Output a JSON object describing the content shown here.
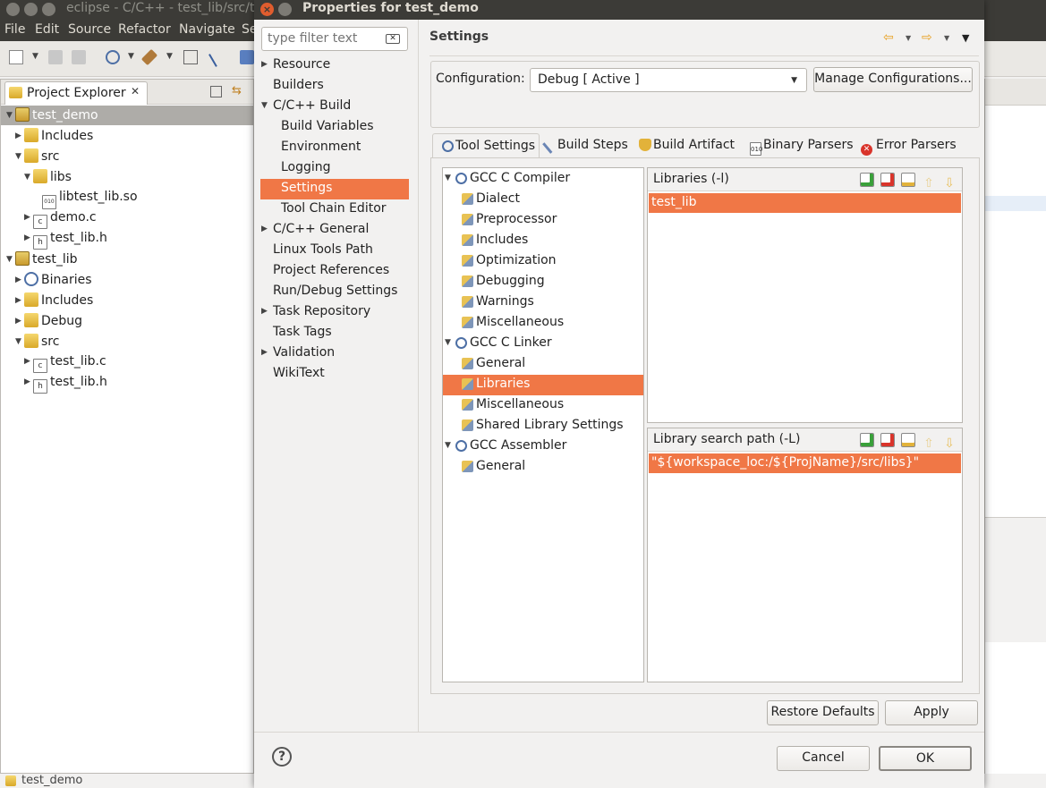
{
  "eclipse": {
    "title": "eclipse - C/C++ - test_lib/src/t",
    "menu": [
      "File",
      "Edit",
      "Source",
      "Refactor",
      "Navigate",
      "Se"
    ],
    "project_explorer": {
      "tab_label": "Project Explorer",
      "tree": [
        {
          "label": "test_demo",
          "depth": 0,
          "expanded": true,
          "icon": "project-icon",
          "selected": true
        },
        {
          "label": "Includes",
          "depth": 1,
          "expanded": false,
          "icon": "includes-icon"
        },
        {
          "label": "src",
          "depth": 1,
          "expanded": true,
          "icon": "folder-icon"
        },
        {
          "label": "libs",
          "depth": 2,
          "expanded": true,
          "icon": "folder-icon"
        },
        {
          "label": "libtest_lib.so",
          "depth": 3,
          "icon": "binary-file-icon"
        },
        {
          "label": "demo.c",
          "depth": 2,
          "expanded": false,
          "icon": "c-file-icon"
        },
        {
          "label": "test_lib.h",
          "depth": 2,
          "expanded": false,
          "icon": "h-file-icon"
        },
        {
          "label": "test_lib",
          "depth": 0,
          "expanded": true,
          "icon": "project-icon"
        },
        {
          "label": "Binaries",
          "depth": 1,
          "expanded": false,
          "icon": "binaries-icon"
        },
        {
          "label": "Includes",
          "depth": 1,
          "expanded": false,
          "icon": "includes-icon"
        },
        {
          "label": "Debug",
          "depth": 1,
          "expanded": false,
          "icon": "folder-icon"
        },
        {
          "label": "src",
          "depth": 1,
          "expanded": true,
          "icon": "folder-icon"
        },
        {
          "label": "test_lib.c",
          "depth": 2,
          "expanded": false,
          "icon": "c-file-icon"
        },
        {
          "label": "test_lib.h",
          "depth": 2,
          "expanded": false,
          "icon": "h-file-icon"
        }
      ]
    },
    "status_text": "test_demo"
  },
  "dialog": {
    "title": "Properties for test_demo",
    "filter_placeholder": "type filter text",
    "nav": [
      {
        "label": "Resource",
        "indent": 0,
        "arrow": true
      },
      {
        "label": "Builders",
        "indent": 0,
        "arrow": false
      },
      {
        "label": "C/C++ Build",
        "indent": 0,
        "arrow": true,
        "expanded": true
      },
      {
        "label": "Build Variables",
        "indent": 1
      },
      {
        "label": "Environment",
        "indent": 1
      },
      {
        "label": "Logging",
        "indent": 1
      },
      {
        "label": "Settings",
        "indent": 1,
        "selected": true
      },
      {
        "label": "Tool Chain Editor",
        "indent": 1
      },
      {
        "label": "C/C++ General",
        "indent": 0,
        "arrow": true
      },
      {
        "label": "Linux Tools Path",
        "indent": 0
      },
      {
        "label": "Project References",
        "indent": 0
      },
      {
        "label": "Run/Debug Settings",
        "indent": 0
      },
      {
        "label": "Task Repository",
        "indent": 0,
        "arrow": true
      },
      {
        "label": "Task Tags",
        "indent": 0
      },
      {
        "label": "Validation",
        "indent": 0,
        "arrow": true
      },
      {
        "label": "WikiText",
        "indent": 0
      }
    ],
    "page_title": "Settings",
    "configuration": {
      "label": "Configuration:",
      "value": "Debug  [ Active ]",
      "manage_button": "Manage Configurations..."
    },
    "tabs": [
      {
        "label": "Tool Settings",
        "active": true,
        "icon": "tool-settings-icon"
      },
      {
        "label": "Build Steps",
        "icon": "build-steps-icon"
      },
      {
        "label": "Build Artifact",
        "icon": "build-artifact-icon"
      },
      {
        "label": "Binary Parsers",
        "icon": "binary-parsers-icon"
      },
      {
        "label": "Error Parsers",
        "icon": "error-parsers-icon"
      }
    ],
    "tool_tree": [
      {
        "label": "GCC C Compiler",
        "level": 0
      },
      {
        "label": "Dialect",
        "level": 1
      },
      {
        "label": "Preprocessor",
        "level": 1
      },
      {
        "label": "Includes",
        "level": 1
      },
      {
        "label": "Optimization",
        "level": 1
      },
      {
        "label": "Debugging",
        "level": 1
      },
      {
        "label": "Warnings",
        "level": 1
      },
      {
        "label": "Miscellaneous",
        "level": 1
      },
      {
        "label": "GCC C Linker",
        "level": 0
      },
      {
        "label": "General",
        "level": 1
      },
      {
        "label": "Libraries",
        "level": 1,
        "selected": true
      },
      {
        "label": "Miscellaneous",
        "level": 1
      },
      {
        "label": "Shared Library Settings",
        "level": 1
      },
      {
        "label": "GCC Assembler",
        "level": 0
      },
      {
        "label": "General",
        "level": 1
      }
    ],
    "libraries": {
      "title": "Libraries (-l)",
      "items": [
        "test_lib"
      ]
    },
    "library_paths": {
      "title": "Library search path (-L)",
      "items": [
        "\"${workspace_loc:/${ProjName}/src/libs}\""
      ]
    },
    "restore_defaults": "Restore Defaults",
    "apply": "Apply",
    "cancel": "Cancel",
    "ok": "OK",
    "help": "?"
  },
  "colors": {
    "selection": "#f07746",
    "titlebar": "#3c3b37",
    "close_button": "#e05d2e"
  }
}
